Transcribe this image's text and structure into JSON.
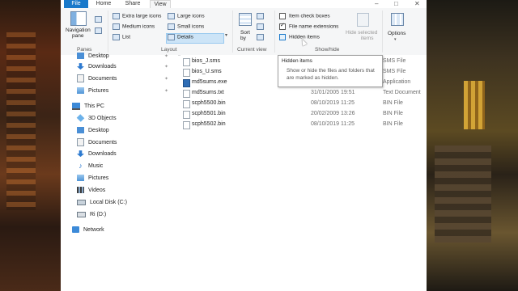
{
  "ribbon_tabs": [
    "File",
    "Home",
    "Share",
    "View"
  ],
  "window_controls": [
    "–",
    "□",
    "✕"
  ],
  "ribbon": {
    "navigation_pane": {
      "line1": "Navigation",
      "line2": "pane"
    },
    "panes_group": "Panes",
    "layout_options": [
      "Extra large icons",
      "Large icons",
      "Medium icons",
      "Small icons",
      "List",
      "Details"
    ],
    "layout_selected": "Details",
    "layout_group": "Layout",
    "sort_by": {
      "line1": "Sort",
      "line2": "by"
    },
    "current_view_group": "Current view",
    "checkboxes": [
      {
        "label": "Item check boxes",
        "checked": false
      },
      {
        "label": "File name extensions",
        "checked": true
      },
      {
        "label": "Hidden items",
        "checked": false
      }
    ],
    "hide_selected": {
      "line1": "Hide selected",
      "line2": "items"
    },
    "show_hide_group": "Show/hide",
    "options": "Options"
  },
  "nav_pane": {
    "quick_access": [
      {
        "label": "Desktop",
        "icon": "desktop-icon"
      },
      {
        "label": "Downloads",
        "icon": "download-icon"
      },
      {
        "label": "Documents",
        "icon": "documents-icon"
      },
      {
        "label": "Pictures",
        "icon": "pictures-icon"
      }
    ],
    "this_pc": "This PC",
    "pc_items": [
      {
        "label": "3D Objects",
        "icon": "cube-icon"
      },
      {
        "label": "Desktop",
        "icon": "desktop-icon"
      },
      {
        "label": "Documents",
        "icon": "documents-icon"
      },
      {
        "label": "Downloads",
        "icon": "download-icon"
      },
      {
        "label": "Music",
        "icon": "music-icon"
      },
      {
        "label": "Pictures",
        "icon": "pictures-icon"
      },
      {
        "label": "Videos",
        "icon": "video-icon"
      },
      {
        "label": "Local Disk (C:)",
        "icon": "drive-icon"
      },
      {
        "label": "Ri (D:)",
        "icon": "drive-icon"
      }
    ],
    "network": "Network"
  },
  "files": [
    {
      "name": "bios_J.sms",
      "date": "",
      "type": "SMS File"
    },
    {
      "name": "bios_U.sms",
      "date": "",
      "type": "SMS File"
    },
    {
      "name": "md5sums.exe",
      "date": "",
      "type": "Application"
    },
    {
      "name": "md5sums.txt",
      "date": "31/01/2005 19:51",
      "type": "Text Document"
    },
    {
      "name": "scph5500.bin",
      "date": "08/10/2019 11:25",
      "type": "BIN File"
    },
    {
      "name": "scph5501.bin",
      "date": "20/02/2009 13:26",
      "type": "BIN File"
    },
    {
      "name": "scph5502.bin",
      "date": "08/10/2019 11:25",
      "type": "BIN File"
    }
  ],
  "tooltip": {
    "title": "Hidden items",
    "description": "Show or hide the files and folders that are marked as hidden."
  }
}
